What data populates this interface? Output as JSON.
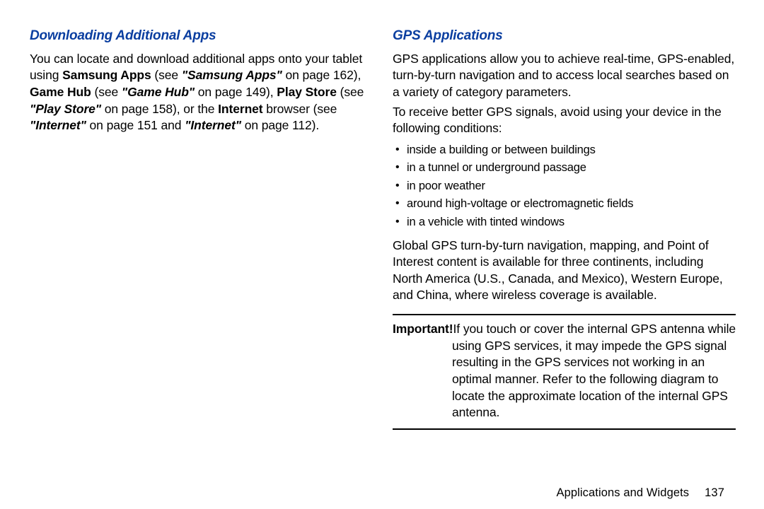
{
  "left": {
    "heading": "Downloading Additional Apps",
    "para_plain_1": "You can locate and download additional apps onto your tablet using ",
    "b1": "Samsung Apps",
    "t1": " (see ",
    "bi1": "\"Samsung Apps\"",
    "t2": " on page 162), ",
    "b2": "Game Hub",
    "t3": " (see ",
    "bi2": "\"Game Hub\"",
    "t4": " on page 149), ",
    "b3": "Play Store",
    "t5": " (see ",
    "bi3": "\"Play Store\"",
    "t6": " on page 158), or the ",
    "b4": "Internet",
    "t7": " browser (see ",
    "bi4": "\"Internet\"",
    "t8": " on page 151 and ",
    "bi5": "\"Internet\"",
    "t9": " on page 112)."
  },
  "right": {
    "heading": "GPS Applications",
    "p1": "GPS applications allow you to achieve real-time, GPS-enabled, turn-by-turn navigation and to access local searches based on a variety of category parameters.",
    "p2": "To receive better GPS signals, avoid using your device in the following conditions:",
    "bullets": [
      "inside a building or between buildings",
      "in a tunnel or underground passage",
      "in poor weather",
      "around high-voltage or electromagnetic fields",
      "in a vehicle with tinted windows"
    ],
    "p3": "Global GPS turn-by-turn navigation, mapping, and Point of Interest content is available for three continents, including North America (U.S., Canada, and Mexico), Western Europe, and China, where wireless coverage is available.",
    "note_label": "Important!",
    "note_text": " If you touch or cover the internal GPS antenna while using GPS services, it may impede the GPS signal resulting in the GPS services not working in an optimal manner. Refer to the following diagram to locate the approximate location of the internal GPS antenna."
  },
  "footer": {
    "section": "Applications and Widgets",
    "page": "137"
  }
}
